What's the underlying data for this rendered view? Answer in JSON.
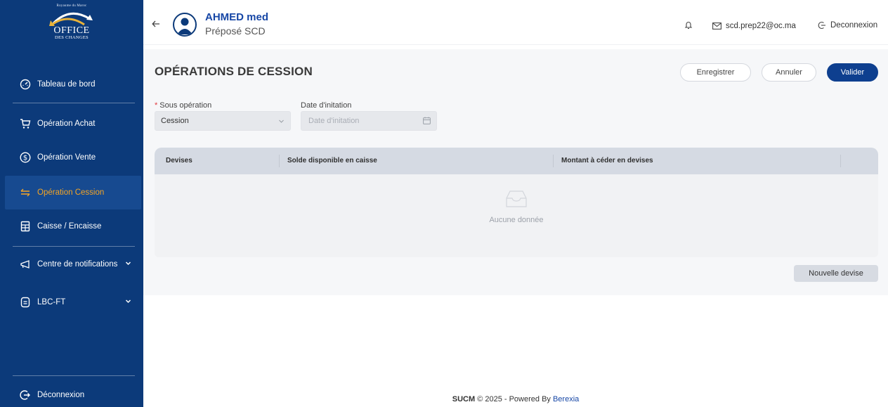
{
  "sidebar": {
    "logo": {
      "kingdom": "Royaume du Maroc",
      "office": "OFFICE",
      "changes": "DES CHANGES"
    },
    "items": [
      {
        "label": "Tableau de bord",
        "icon": "gauge-icon"
      },
      {
        "label": "Opération Achat",
        "icon": "cart-icon"
      },
      {
        "label": "Opération Vente",
        "icon": "dollar-icon"
      },
      {
        "label": "Opération Cession",
        "icon": "swap-icon",
        "active": true
      },
      {
        "label": "Caisse / Encaisse",
        "icon": "calculator-icon"
      },
      {
        "label": "Centre de notifications",
        "icon": "megaphone-icon"
      },
      {
        "label": "LBC-FT",
        "icon": "document-icon"
      }
    ],
    "logout_label": "Déconnexion"
  },
  "header": {
    "user_name": "AHMED med",
    "user_role": "Préposé SCD",
    "email": "scd.prep22@oc.ma",
    "logout_label": "Deconnexion"
  },
  "page": {
    "title": "OPÉRATIONS DE CESSION",
    "buttons": {
      "save": "Enregistrer",
      "cancel": "Annuler",
      "validate": "Valider"
    },
    "form": {
      "sub_operation_label": "Sous opération",
      "sub_operation_value": "Cession",
      "date_label": "Date d'initation",
      "date_placeholder": "Date d'initation"
    },
    "table": {
      "columns": [
        "Devises",
        "Solde disponible en caisse",
        "Montant à céder en devises"
      ],
      "empty_text": "Aucune donnée"
    },
    "new_currency_button": "Nouvelle devise"
  },
  "footer": {
    "app": "SUCM",
    "copyright": "© 2025 - Powered By",
    "brand": "Berexia"
  },
  "colors": {
    "sidebar_bg": "#0c3a7a",
    "active_accent": "#f5a524",
    "primary": "#0e3f8f",
    "link_blue": "#1747a6"
  }
}
